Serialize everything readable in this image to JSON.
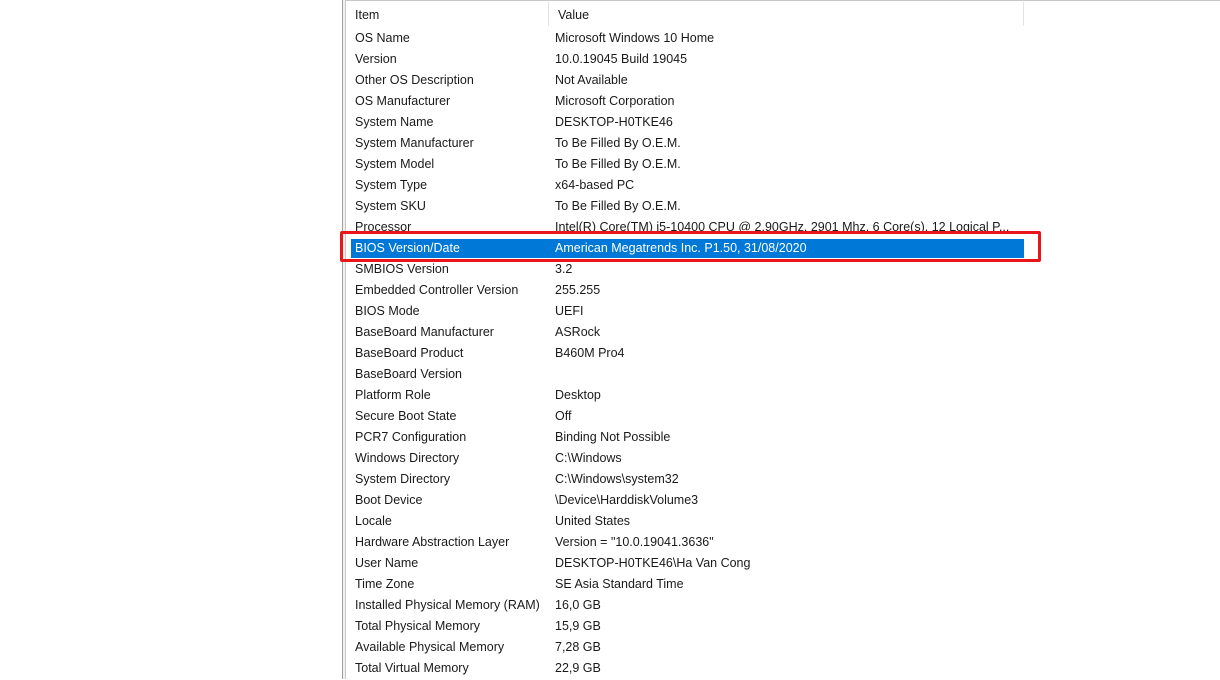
{
  "columns": {
    "item": "Item",
    "value": "Value"
  },
  "selected_index": 10,
  "highlight_color": "#e8151a",
  "selection_color": "#0078d7",
  "rows": [
    {
      "item": "OS Name",
      "value": "Microsoft Windows 10 Home"
    },
    {
      "item": "Version",
      "value": "10.0.19045 Build 19045"
    },
    {
      "item": "Other OS Description",
      "value": "Not Available"
    },
    {
      "item": "OS Manufacturer",
      "value": "Microsoft Corporation"
    },
    {
      "item": "System Name",
      "value": "DESKTOP-H0TKE46"
    },
    {
      "item": "System Manufacturer",
      "value": "To Be Filled By O.E.M."
    },
    {
      "item": "System Model",
      "value": "To Be Filled By O.E.M."
    },
    {
      "item": "System Type",
      "value": "x64-based PC"
    },
    {
      "item": "System SKU",
      "value": "To Be Filled By O.E.M."
    },
    {
      "item": "Processor",
      "value": "Intel(R) Core(TM) i5-10400 CPU @ 2.90GHz, 2901 Mhz, 6 Core(s), 12 Logical P..."
    },
    {
      "item": "BIOS Version/Date",
      "value": "American Megatrends Inc. P1.50, 31/08/2020"
    },
    {
      "item": "SMBIOS Version",
      "value": "3.2"
    },
    {
      "item": "Embedded Controller Version",
      "value": "255.255"
    },
    {
      "item": "BIOS Mode",
      "value": "UEFI"
    },
    {
      "item": "BaseBoard Manufacturer",
      "value": "ASRock"
    },
    {
      "item": "BaseBoard Product",
      "value": "B460M Pro4"
    },
    {
      "item": "BaseBoard Version",
      "value": ""
    },
    {
      "item": "Platform Role",
      "value": "Desktop"
    },
    {
      "item": "Secure Boot State",
      "value": "Off"
    },
    {
      "item": "PCR7 Configuration",
      "value": "Binding Not Possible"
    },
    {
      "item": "Windows Directory",
      "value": "C:\\Windows"
    },
    {
      "item": "System Directory",
      "value": "C:\\Windows\\system32"
    },
    {
      "item": "Boot Device",
      "value": "\\Device\\HarddiskVolume3"
    },
    {
      "item": "Locale",
      "value": "United States"
    },
    {
      "item": "Hardware Abstraction Layer",
      "value": "Version = \"10.0.19041.3636\""
    },
    {
      "item": "User Name",
      "value": "DESKTOP-H0TKE46\\Ha Van Cong"
    },
    {
      "item": "Time Zone",
      "value": "SE Asia Standard Time"
    },
    {
      "item": "Installed Physical Memory (RAM)",
      "value": "16,0 GB"
    },
    {
      "item": "Total Physical Memory",
      "value": "15,9 GB"
    },
    {
      "item": "Available Physical Memory",
      "value": "7,28 GB"
    },
    {
      "item": "Total Virtual Memory",
      "value": "22,9 GB"
    }
  ]
}
